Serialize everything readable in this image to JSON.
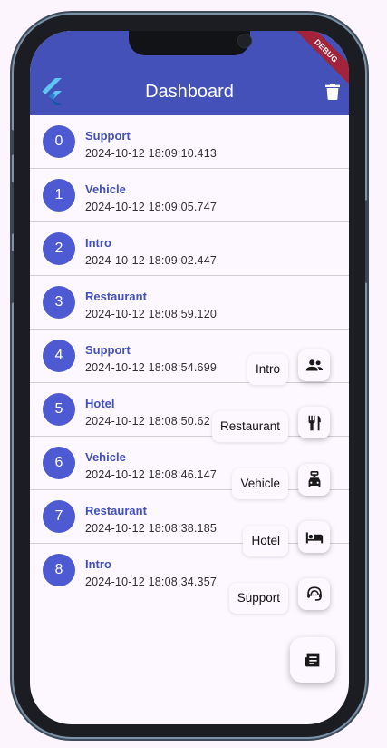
{
  "appbar": {
    "title": "Dashboard",
    "debug_banner": "DEBUG"
  },
  "list": {
    "items": [
      {
        "index": "0",
        "title": "Support",
        "timestamp": "2024-10-12 18:09:10.413"
      },
      {
        "index": "1",
        "title": "Vehicle",
        "timestamp": "2024-10-12 18:09:05.747"
      },
      {
        "index": "2",
        "title": "Intro",
        "timestamp": "2024-10-12 18:09:02.447"
      },
      {
        "index": "3",
        "title": "Restaurant",
        "timestamp": "2024-10-12 18:08:59.120"
      },
      {
        "index": "4",
        "title": "Support",
        "timestamp": "2024-10-12 18:08:54.699"
      },
      {
        "index": "5",
        "title": "Hotel",
        "timestamp": "2024-10-12 18:08:50.62"
      },
      {
        "index": "6",
        "title": "Vehicle",
        "timestamp": "2024-10-12 18:08:46.147"
      },
      {
        "index": "7",
        "title": "Restaurant",
        "timestamp": "2024-10-12 18:08:38.185"
      },
      {
        "index": "8",
        "title": "Intro",
        "timestamp": "2024-10-12 18:08:34.357"
      }
    ]
  },
  "fab_menu": {
    "items": [
      {
        "label": "Intro",
        "icon": "people-icon"
      },
      {
        "label": "Restaurant",
        "icon": "restaurant-icon"
      },
      {
        "label": "Vehicle",
        "icon": "vehicle-icon"
      },
      {
        "label": "Hotel",
        "icon": "hotel-bed-icon"
      },
      {
        "label": "Support",
        "icon": "support-agent-icon"
      }
    ],
    "main_icon": "receipt-icon"
  },
  "colors": {
    "primary": "#4351b8",
    "avatar": "#4d5ad2",
    "background": "#fdf7ff",
    "debug": "#a1243a"
  }
}
